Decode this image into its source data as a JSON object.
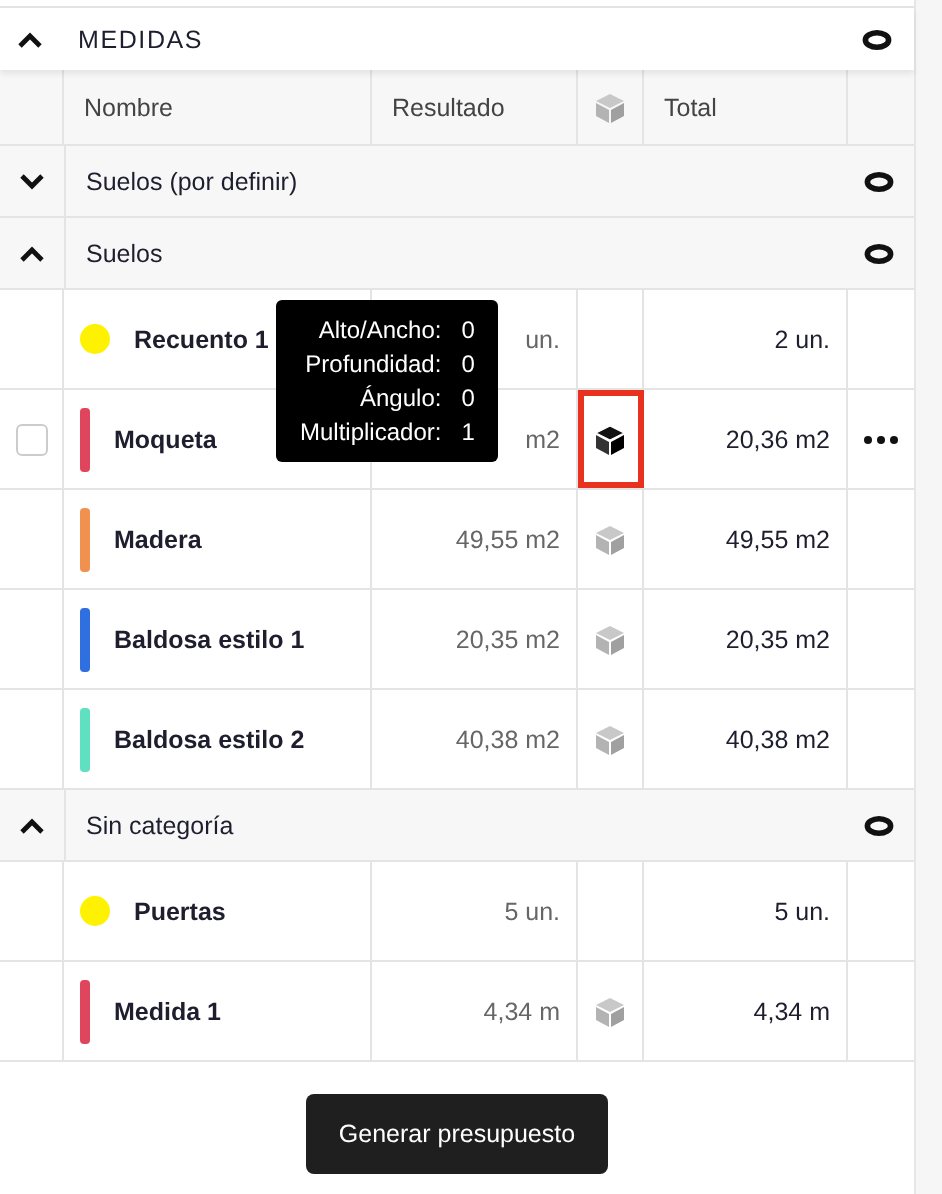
{
  "section": {
    "title": "MEDIDAS",
    "expanded": true
  },
  "columns": [
    "Nombre",
    "Resultado",
    "Total"
  ],
  "groups": [
    {
      "label": "Suelos (por definir)",
      "expanded": false
    },
    {
      "label": "Suelos",
      "expanded": true,
      "items": [
        {
          "name": "Recuento 1",
          "kind": "dot",
          "color": "#fff200",
          "result": "un.",
          "total": "2 un.",
          "cube_shown": false,
          "cube_active": false,
          "hovered": false
        },
        {
          "name": "Moqueta",
          "kind": "bar",
          "color": "#e0455e",
          "result": "m2",
          "total": "20,36 m2",
          "cube_shown": true,
          "cube_active": true,
          "hovered": true,
          "checked": false
        },
        {
          "name": "Madera",
          "kind": "bar",
          "color": "#f0914f",
          "result": "49,55 m2",
          "total": "49,55 m2",
          "cube_shown": true,
          "cube_active": false,
          "hovered": false
        },
        {
          "name": "Baldosa estilo 1",
          "kind": "bar",
          "color": "#2f6fe0",
          "result": "20,35 m2",
          "total": "20,35 m2",
          "cube_shown": true,
          "cube_active": false,
          "hovered": false
        },
        {
          "name": "Baldosa estilo 2",
          "kind": "bar",
          "color": "#5fe0c0",
          "result": "40,38 m2",
          "total": "40,38 m2",
          "cube_shown": true,
          "cube_active": false,
          "hovered": false
        }
      ]
    },
    {
      "label": "Sin categoría",
      "expanded": true,
      "items": [
        {
          "name": "Puertas",
          "kind": "dot",
          "color": "#fff200",
          "result": "5 un.",
          "total": "5 un.",
          "cube_shown": false,
          "cube_active": false,
          "hovered": false
        },
        {
          "name": "Medida 1",
          "kind": "bar",
          "color": "#e0455e",
          "result": "4,34 m",
          "total": "4,34 m",
          "cube_shown": true,
          "cube_active": false,
          "hovered": false
        }
      ]
    }
  ],
  "tooltip": {
    "rows": [
      {
        "label": "Alto/Ancho:",
        "value": "0"
      },
      {
        "label": "Profundidad:",
        "value": "0"
      },
      {
        "label": "Ángulo:",
        "value": "0"
      },
      {
        "label": "Multiplicador:",
        "value": "1"
      }
    ]
  },
  "button": "Generar presupuesto"
}
